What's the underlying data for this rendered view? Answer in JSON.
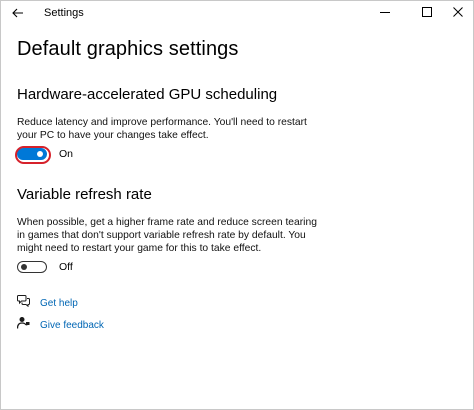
{
  "window": {
    "title": "Settings",
    "minimize_glyph": "—",
    "maximize_glyph": "☐",
    "close_glyph": "✕"
  },
  "page": {
    "title": "Default graphics settings"
  },
  "gpu_scheduling": {
    "heading": "Hardware-accelerated GPU scheduling",
    "description": "Reduce latency and improve performance. You'll need to restart your PC to have your changes take effect.",
    "toggle_state": "On"
  },
  "variable_refresh": {
    "heading": "Variable refresh rate",
    "description": "When possible, get a higher frame rate and reduce screen tearing in games that don't support variable refresh rate by default. You might need to restart your game for this to take effect.",
    "toggle_state": "Off"
  },
  "links": {
    "get_help": "Get help",
    "give_feedback": "Give feedback"
  },
  "colors": {
    "accent": "#0078d7",
    "link": "#0066b4",
    "focus_ring": "#d6212b"
  },
  "icons": {
    "back": "back-arrow-icon",
    "help": "chat-bubble-help-icon",
    "feedback": "person-feedback-icon"
  }
}
